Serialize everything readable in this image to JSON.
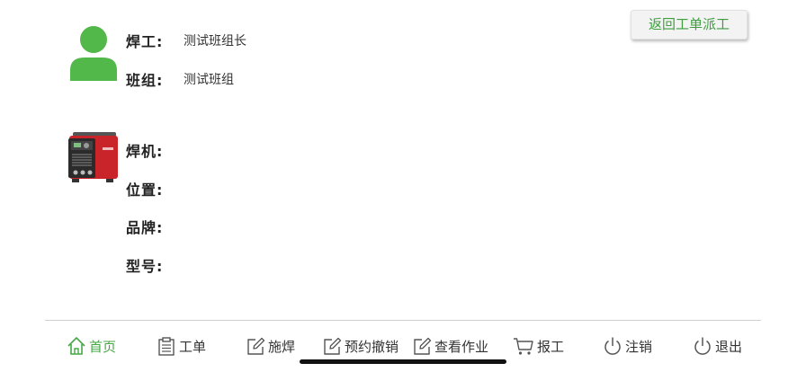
{
  "header": {
    "return_button": "返回工单派工"
  },
  "welder": {
    "name_label": "焊工:",
    "name_value": "测试班组长",
    "team_label": "班组:",
    "team_value": "测试班组"
  },
  "machine": {
    "machine_label": "焊机:",
    "machine_value": "",
    "position_label": "位置:",
    "position_value": "",
    "brand_label": "品牌:",
    "brand_value": "",
    "model_label": "型号:",
    "model_value": ""
  },
  "nav": {
    "items": [
      {
        "label": "首页",
        "icon": "home-icon",
        "active": true
      },
      {
        "label": "工单",
        "icon": "clipboard-icon"
      },
      {
        "label": "施焊",
        "icon": "edit-icon"
      },
      {
        "label": "预约撤销",
        "icon": "edit-icon"
      },
      {
        "label": "查看作业",
        "icon": "edit-icon"
      },
      {
        "label": "报工",
        "icon": "cart-icon"
      },
      {
        "label": "注销",
        "icon": "power-icon"
      },
      {
        "label": "退出",
        "icon": "power-icon"
      }
    ]
  },
  "colors": {
    "accent": "#45a845",
    "avatar": "#52b84a",
    "machine_red": "#c8242a"
  }
}
